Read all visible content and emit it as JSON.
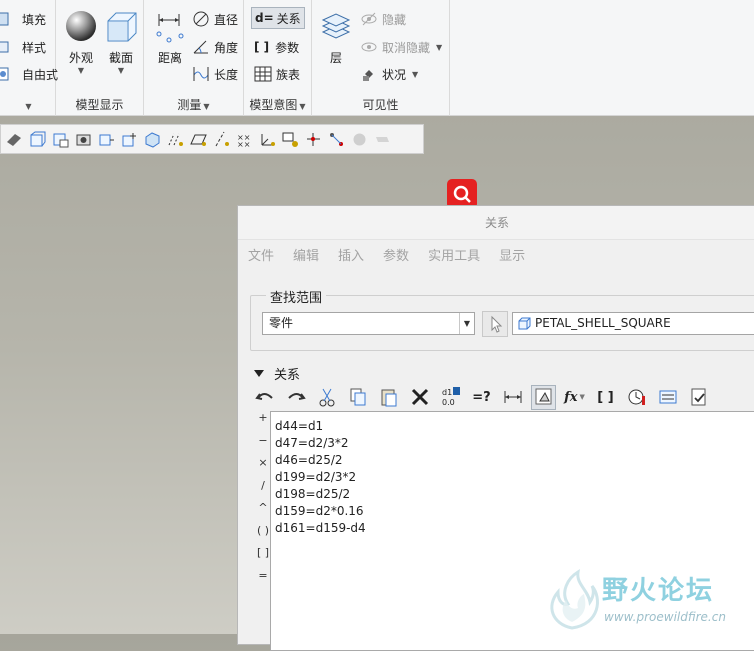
{
  "ribbon": {
    "left_items": [
      {
        "label": "填充",
        "icon": "fill-icon"
      },
      {
        "label": "样式",
        "icon": "style-icon"
      },
      {
        "label": "自由式",
        "icon": "freestyle-icon"
      }
    ],
    "model_display": {
      "label": "模型显示",
      "appearance": "外观",
      "section": "截面"
    },
    "measure": {
      "label": "测量",
      "distance": "距离",
      "diameter": "直径",
      "angle": "角度",
      "length": "长度"
    },
    "model_intent": {
      "label": "模型意图",
      "relations": "关系",
      "parameters": "参数",
      "family_table": "族表",
      "relations_icon_text": "d="
    },
    "visibility": {
      "label": "可见性",
      "layers": "层",
      "hide": "隐藏",
      "unhide": "取消隐藏",
      "status": "状况"
    }
  },
  "dialog": {
    "title": "关系",
    "menu": [
      "文件",
      "编辑",
      "插入",
      "参数",
      "实用工具",
      "显示"
    ],
    "scope_label": "查找范围",
    "scope_value": "零件",
    "part_name": "PETAL_SHELL_SQUARE",
    "section_label": "关系",
    "operators": [
      "+",
      "−",
      "×",
      "/",
      "^",
      "( )",
      "[ ]",
      "="
    ],
    "relations": [
      "d44=d1",
      "d47=d2/3*2",
      "d46=d25/2",
      "d199=d2/3*2",
      "d198=d25/2",
      "d159=d2*0.16",
      "d161=d159-d4"
    ],
    "toolbar_text": {
      "eq_check": "=?",
      "func": "fx",
      "brackets": "[ ]",
      "d1_top": "d1",
      "d1_bottom": "0.0"
    }
  },
  "watermark": {
    "title": "野火论坛",
    "url": "www.proewildfire.cn"
  }
}
